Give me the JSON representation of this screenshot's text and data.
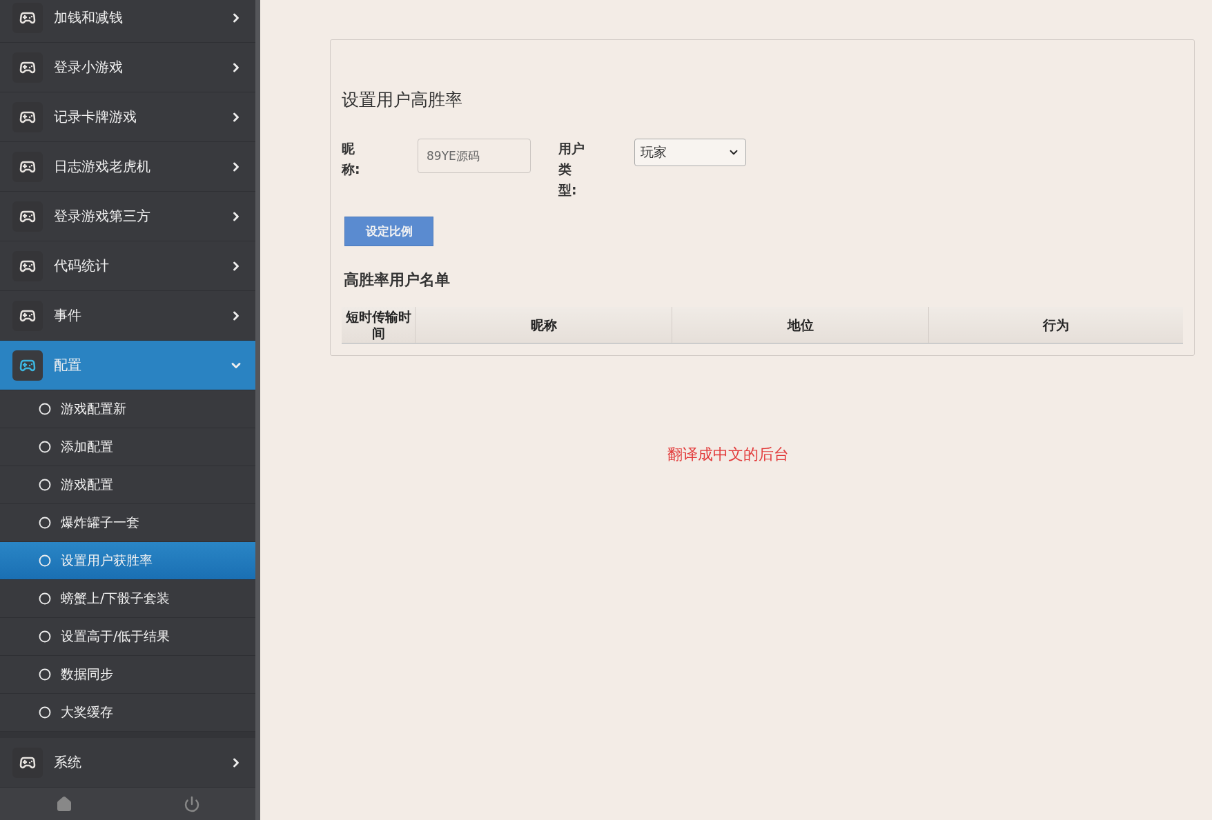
{
  "sidebar": {
    "items": [
      {
        "label": "加钱和减钱",
        "expanded": false,
        "selected": false
      },
      {
        "label": "登录小游戏",
        "expanded": false,
        "selected": false
      },
      {
        "label": "记录卡牌游戏",
        "expanded": false,
        "selected": false
      },
      {
        "label": "日志游戏老虎机",
        "expanded": false,
        "selected": false
      },
      {
        "label": "登录游戏第三方",
        "expanded": false,
        "selected": false
      },
      {
        "label": "代码统计",
        "expanded": false,
        "selected": false
      },
      {
        "label": "事件",
        "expanded": false,
        "selected": false
      },
      {
        "label": "配置",
        "expanded": true,
        "selected": true,
        "children": [
          {
            "label": "游戏配置新",
            "selected": false
          },
          {
            "label": "添加配置",
            "selected": false
          },
          {
            "label": "游戏配置",
            "selected": false
          },
          {
            "label": "爆炸罐子一套",
            "selected": false
          },
          {
            "label": "设置用户获胜率",
            "selected": true
          },
          {
            "label": "螃蟹上/下骰子套装",
            "selected": false
          },
          {
            "label": "设置高于/低于结果",
            "selected": false
          },
          {
            "label": "数据同步",
            "selected": false
          },
          {
            "label": "大奖缓存",
            "selected": false
          }
        ]
      },
      {
        "label": "系统",
        "expanded": false,
        "selected": false
      }
    ]
  },
  "panel": {
    "title": "设置用户高胜率",
    "form": {
      "nickname_label": "昵称:",
      "nickname_placeholder": "89YE源码",
      "user_type_label": "用户类型:",
      "user_type_value": "玩家",
      "submit": "设定比例"
    },
    "list_title": "高胜率用户名单",
    "table": {
      "columns": [
        "短时传输时间",
        "昵称",
        "地位",
        "行为"
      ]
    }
  },
  "notice": "翻译成中文的后台"
}
